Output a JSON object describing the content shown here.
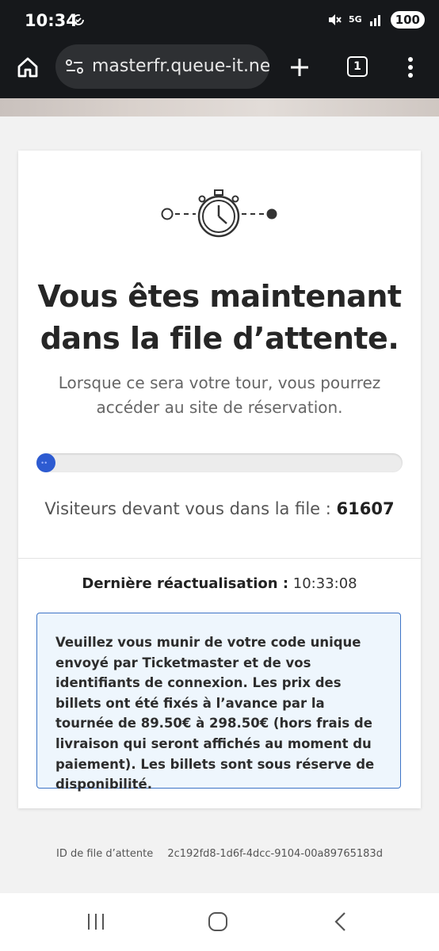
{
  "status_bar": {
    "time": "10:34",
    "network": "5G",
    "battery": "100"
  },
  "browser": {
    "url": "masterfr.queue-it.net",
    "tab_count": "1"
  },
  "queue": {
    "title": "Vous êtes maintenant dans la file d’attente.",
    "subtitle": "Lorsque ce sera votre tour, vous pourrez accéder au site de réservation.",
    "visitors_ahead_label": "Visiteurs devant vous dans la file :",
    "visitors_ahead_value": "61607",
    "last_update_label": "Dernière réactualisation :",
    "last_update_value": "10:33:08",
    "notice": "Veuillez vous munir de votre code unique envoyé par Ticketmaster et de vos identifiants de connexion. Les prix des billets ont été fixés à l’avance par la tournée de 89.50€ à 298.50€ (hors frais de livraison qui seront affichés au moment du paiement). Les billets sont sous réserve de disponibilité.",
    "queue_id_label": "ID de file d’attente",
    "queue_id_value": "2c192fd8-1d6f-4dcc-9104-00a89765183d"
  },
  "colors": {
    "accent": "#2d5bd1",
    "notice_border": "#3d74c6",
    "notice_bg": "#eef6fd"
  },
  "icons": {
    "status": [
      "sync-icon",
      "mute-icon",
      "signal-icon"
    ],
    "toolbar": [
      "home-icon",
      "site-settings-icon",
      "new-tab-icon",
      "tab-switcher-icon",
      "menu-icon"
    ],
    "hero": "stopwatch-icon",
    "nav": [
      "recent-apps-icon",
      "home-button-icon",
      "back-icon"
    ]
  }
}
